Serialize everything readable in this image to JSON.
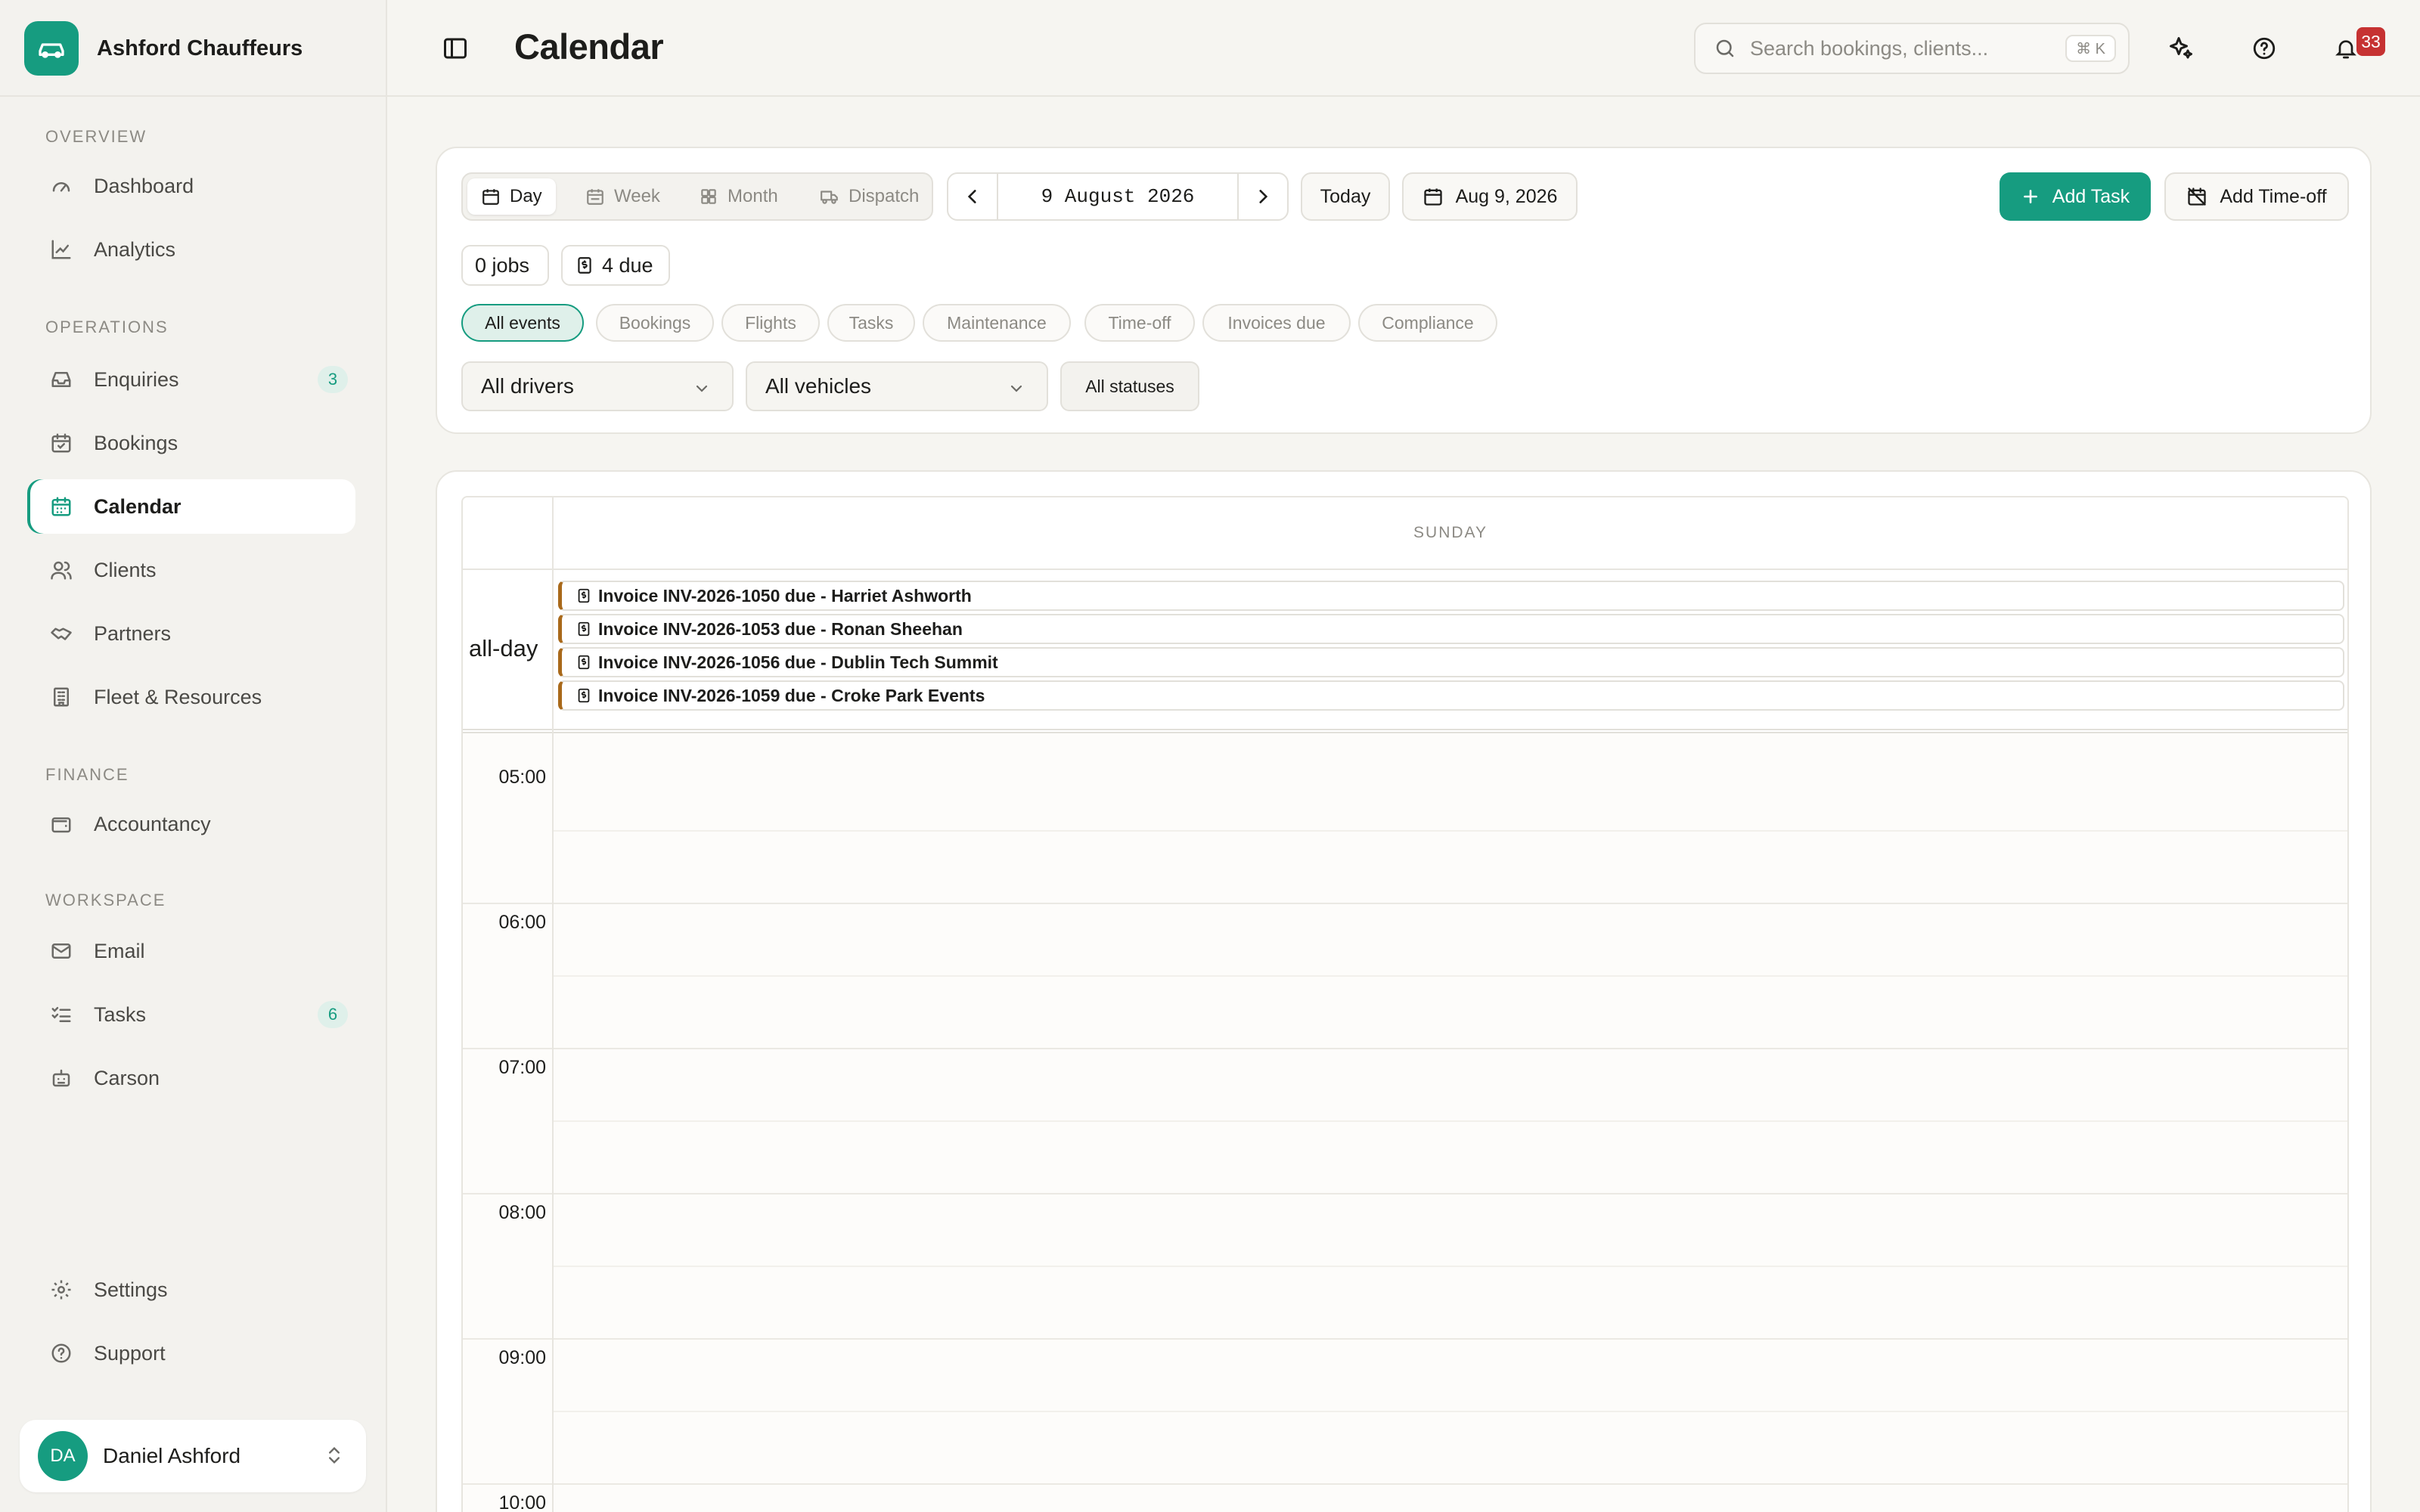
{
  "brand": {
    "name": "Ashford Chauffeurs"
  },
  "sidebar": {
    "sections": [
      {
        "title": "OVERVIEW"
      },
      {
        "title": "OPERATIONS"
      },
      {
        "title": "FINANCE"
      },
      {
        "title": "WORKSPACE"
      }
    ],
    "items": [
      {
        "label": "Dashboard",
        "icon": "gauge-icon"
      },
      {
        "label": "Analytics",
        "icon": "line-chart-icon"
      },
      {
        "label": "Enquiries",
        "icon": "inbox-icon",
        "badge": "3"
      },
      {
        "label": "Bookings",
        "icon": "calendar-check-icon"
      },
      {
        "label": "Calendar",
        "icon": "calendar-icon",
        "active": true
      },
      {
        "label": "Clients",
        "icon": "users-icon"
      },
      {
        "label": "Partners",
        "icon": "handshake-icon"
      },
      {
        "label": "Fleet & Resources",
        "icon": "building-icon"
      },
      {
        "label": "Accountancy",
        "icon": "wallet-icon"
      },
      {
        "label": "Email",
        "icon": "mail-icon"
      },
      {
        "label": "Tasks",
        "icon": "list-checks-icon",
        "badge": "6"
      },
      {
        "label": "Carson",
        "icon": "bot-icon"
      },
      {
        "label": "Settings",
        "icon": "gear-icon"
      },
      {
        "label": "Support",
        "icon": "help-circle-icon"
      }
    ],
    "user": {
      "initials": "DA",
      "name": "Daniel Ashford"
    }
  },
  "header": {
    "title": "Calendar",
    "search_placeholder": "Search bookings, clients...",
    "search_shortcut": "⌘ K",
    "notification_count": "33"
  },
  "toolbar": {
    "views": [
      {
        "label": "Day",
        "active": true
      },
      {
        "label": "Week"
      },
      {
        "label": "Month"
      },
      {
        "label": "Dispatch"
      }
    ],
    "current_date": "9 August 2026",
    "today_label": "Today",
    "date_picker": "Aug 9, 2026",
    "add_task": "Add Task",
    "add_timeoff": "Add Time-off",
    "stats": {
      "jobs": "0 jobs",
      "due": "4 due"
    },
    "filters": [
      "All events",
      "Bookings",
      "Flights",
      "Tasks",
      "Maintenance",
      "Time-off",
      "Invoices due",
      "Compliance"
    ],
    "active_filter": "All events",
    "driver_select": "All drivers",
    "vehicle_select": "All vehicles",
    "status_filter": "All statuses"
  },
  "calendar": {
    "day_name": "SUNDAY",
    "allday_label": "all-day",
    "allday_events": [
      "Invoice INV-2026-1050 due - Harriet Ashworth",
      "Invoice INV-2026-1053 due - Ronan Sheehan",
      "Invoice INV-2026-1056 due - Dublin Tech Summit",
      "Invoice INV-2026-1059 due - Croke Park Events"
    ],
    "hours": [
      "05:00",
      "06:00",
      "07:00",
      "08:00",
      "09:00",
      "10:00"
    ],
    "event_accent": "#a9691a"
  },
  "colors": {
    "accent": "#169c80",
    "notification": "#c63232"
  }
}
